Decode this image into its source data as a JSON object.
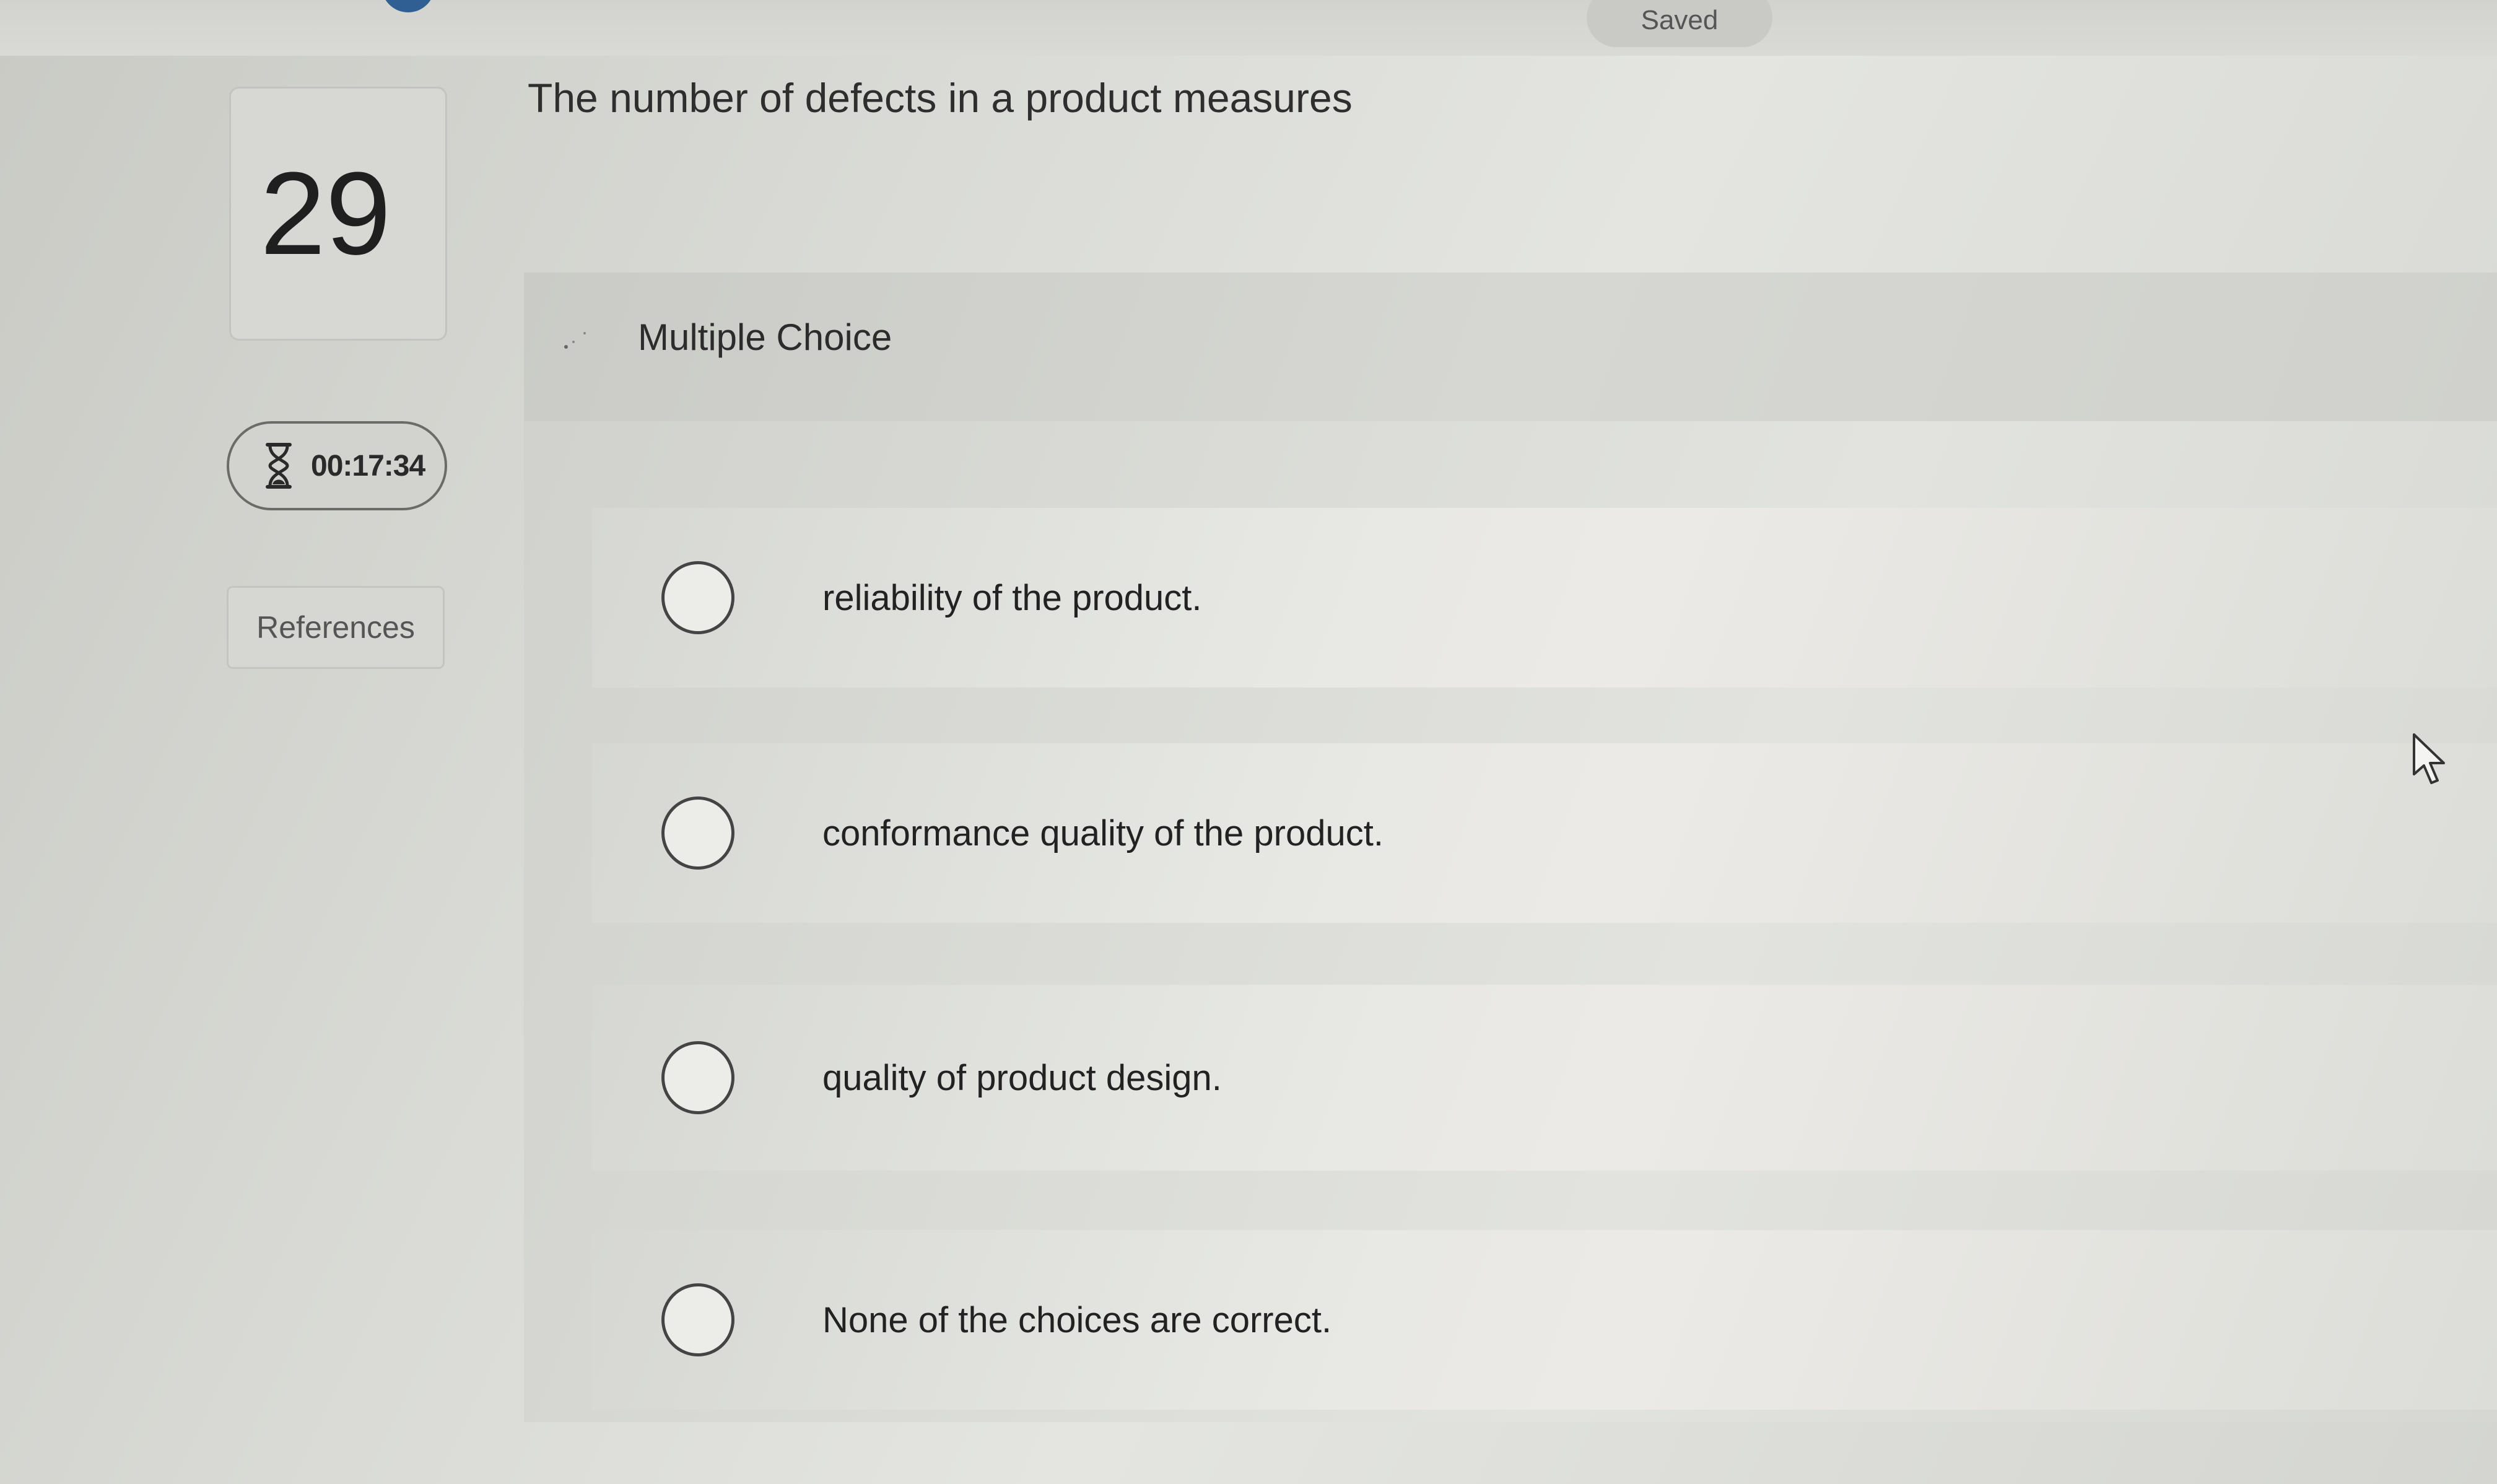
{
  "header": {
    "save_status": "Saved"
  },
  "sidebar": {
    "question_number": "29",
    "timer": "00:17:34",
    "references_label": "References"
  },
  "question": {
    "prompt": "The number of defects in a product measures",
    "type_label": "Multiple Choice",
    "options": [
      {
        "label": "reliability of the product."
      },
      {
        "label": "conformance quality of the product."
      },
      {
        "label": "quality of product design."
      },
      {
        "label": "None of the choices are correct."
      }
    ]
  },
  "icons": {
    "timer": "hourglass-icon",
    "cursor": "mouse-pointer-icon"
  }
}
